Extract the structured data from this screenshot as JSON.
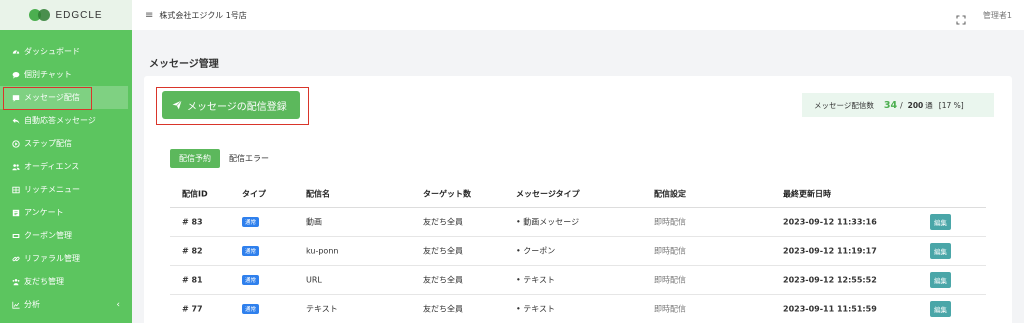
{
  "sidebar": {
    "logo_text": "EDGCLE",
    "items": [
      {
        "label": "ダッシュボード",
        "icon": "dashboard-icon"
      },
      {
        "label": "個別チャット",
        "icon": "chat-icon"
      },
      {
        "label": "メッセージ配信",
        "icon": "message-icon"
      },
      {
        "label": "自動応答メッセージ",
        "icon": "reply-icon"
      },
      {
        "label": "ステップ配信",
        "icon": "step-icon"
      },
      {
        "label": "オーディエンス",
        "icon": "audience-icon"
      },
      {
        "label": "リッチメニュー",
        "icon": "grid-icon"
      },
      {
        "label": "アンケート",
        "icon": "survey-icon"
      },
      {
        "label": "クーポン管理",
        "icon": "coupon-icon"
      },
      {
        "label": "リファラル管理",
        "icon": "link-icon"
      },
      {
        "label": "友だち管理",
        "icon": "friends-icon"
      },
      {
        "label": "分析",
        "icon": "chart-icon"
      }
    ],
    "analysis_caret": "‹"
  },
  "header": {
    "menu_icon": "≡",
    "store_name": "株式会社エジクル 1号店",
    "admin_label": "管理者1"
  },
  "main": {
    "page_title": "メッセージ管理",
    "register_button": "メッセージの配信登録",
    "stats": {
      "label": "メッセージ配信数",
      "current": "34",
      "separator": "/",
      "limit": "200",
      "unit": "通",
      "percent": "[17 %]"
    },
    "tabs": [
      {
        "label": "配信予約"
      },
      {
        "label": "配信エラー"
      }
    ],
    "table": {
      "headers": [
        "配信ID",
        "タイプ",
        "配信名",
        "ターゲット数",
        "メッセージタイプ",
        "配信設定",
        "最終更新日時"
      ],
      "rows": [
        {
          "id": "# 83",
          "type": "通常",
          "name": "動画",
          "target": "友だち全員",
          "msg_type": "動画メッセージ",
          "setting": "即時配信",
          "updated": "2023-09-12 11:33:16",
          "edit": "編集"
        },
        {
          "id": "# 82",
          "type": "通常",
          "name": "ku-ponn",
          "target": "友だち全員",
          "msg_type": "クーポン",
          "setting": "即時配信",
          "updated": "2023-09-12 11:19:17",
          "edit": "編集"
        },
        {
          "id": "# 81",
          "type": "通常",
          "name": "URL",
          "target": "友だち全員",
          "msg_type": "テキスト",
          "setting": "即時配信",
          "updated": "2023-09-12 12:55:52",
          "edit": "編集"
        },
        {
          "id": "# 77",
          "type": "通常",
          "name": "テキスト",
          "target": "友だち全員",
          "msg_type": "テキスト",
          "setting": "即時配信",
          "updated": "2023-09-11 11:51:59",
          "edit": "編集"
        }
      ]
    }
  }
}
